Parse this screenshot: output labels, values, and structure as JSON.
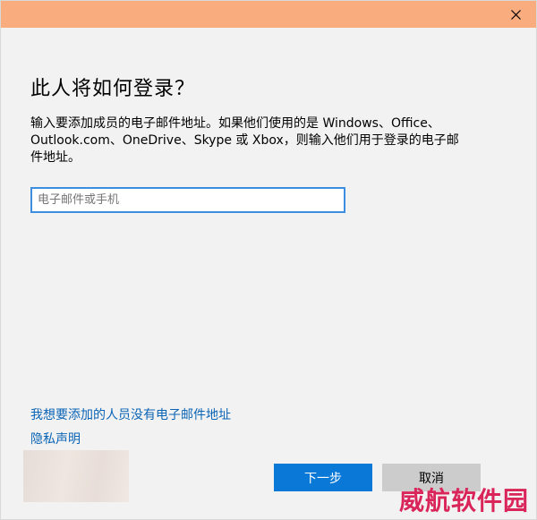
{
  "window": {
    "close_icon": "close-icon",
    "title_bar_color": "#f9ac7e"
  },
  "dialog": {
    "heading": "此人将如何登录？",
    "description": "输入要添加成员的电子邮件地址。如果他们使用的是 Windows、Office、Outlook.com、OneDrive、Skype 或 Xbox，则输入他们用于登录的电子邮件地址。",
    "email_input": {
      "placeholder": "电子邮件或手机",
      "value": ""
    },
    "link_no_email": "我想要添加的人员没有电子邮件地址",
    "link_privacy": "隐私声明",
    "next_button": "下一步",
    "cancel_button": "取消",
    "accent_color": "#0a78d7",
    "link_color": "#0a64b6"
  },
  "watermark": "威航软件园"
}
